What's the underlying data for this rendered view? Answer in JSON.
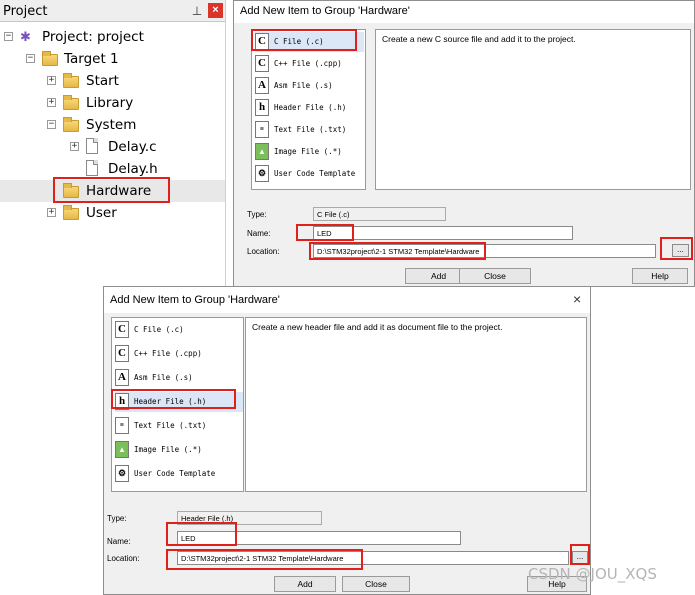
{
  "project_panel": {
    "title": "Project",
    "tree": [
      {
        "label": "Project: project",
        "level": 0
      },
      {
        "label": "Target 1",
        "level": 1
      },
      {
        "label": "Start",
        "level": 2
      },
      {
        "label": "Library",
        "level": 2
      },
      {
        "label": "System",
        "level": 2
      },
      {
        "label": "Delay.c",
        "level": 3
      },
      {
        "label": "Delay.h",
        "level": 3
      },
      {
        "label": "Hardware",
        "level": 2
      },
      {
        "label": "User",
        "level": 2
      }
    ]
  },
  "dialog_c": {
    "title": "Add New Item to Group 'Hardware'",
    "items": [
      {
        "icon": "C",
        "label": "C File (.c)"
      },
      {
        "icon": "C",
        "label": "C++ File (.cpp)"
      },
      {
        "icon": "A",
        "label": "Asm File (.s)"
      },
      {
        "icon": "h",
        "label": "Header File (.h)"
      },
      {
        "icon": "txt",
        "label": "Text File (.txt)"
      },
      {
        "icon": "img",
        "label": "Image File (.*)"
      },
      {
        "icon": "tpl",
        "label": "User Code Template"
      }
    ],
    "description": "Create a new C source file and add it to the project.",
    "type_label": "Type:",
    "type_value": "C File (.c)",
    "name_label": "Name:",
    "name_value": "LED",
    "location_label": "Location:",
    "location_value": "D:\\STM32project\\2-1 STM32 Template\\Hardware",
    "browse_label": "...",
    "add_label": "Add",
    "close_label": "Close",
    "help_label": "Help"
  },
  "dialog_h": {
    "title": "Add New Item to Group 'Hardware'",
    "close_glyph": "×",
    "items": [
      {
        "icon": "C",
        "label": "C File (.c)"
      },
      {
        "icon": "C",
        "label": "C++ File (.cpp)"
      },
      {
        "icon": "A",
        "label": "Asm File (.s)"
      },
      {
        "icon": "h",
        "label": "Header File (.h)"
      },
      {
        "icon": "txt",
        "label": "Text File (.txt)"
      },
      {
        "icon": "img",
        "label": "Image File (.*)"
      },
      {
        "icon": "tpl",
        "label": "User Code Template"
      }
    ],
    "description": "Create a new header file and add it as document file to the project.",
    "type_label": "Type:",
    "type_value": "Header File (.h)",
    "name_label": "Name:",
    "name_value": "LED",
    "location_label": "Location:",
    "location_value": "D:\\STM32project\\2-1 STM32 Template\\Hardware",
    "browse_label": "...",
    "add_label": "Add",
    "close_label": "Close",
    "help_label": "Help"
  },
  "watermark": "CSDN @JOU_XQS",
  "colors": {
    "highlight_box": "#e0201b",
    "selection": "#dbe7f7"
  }
}
